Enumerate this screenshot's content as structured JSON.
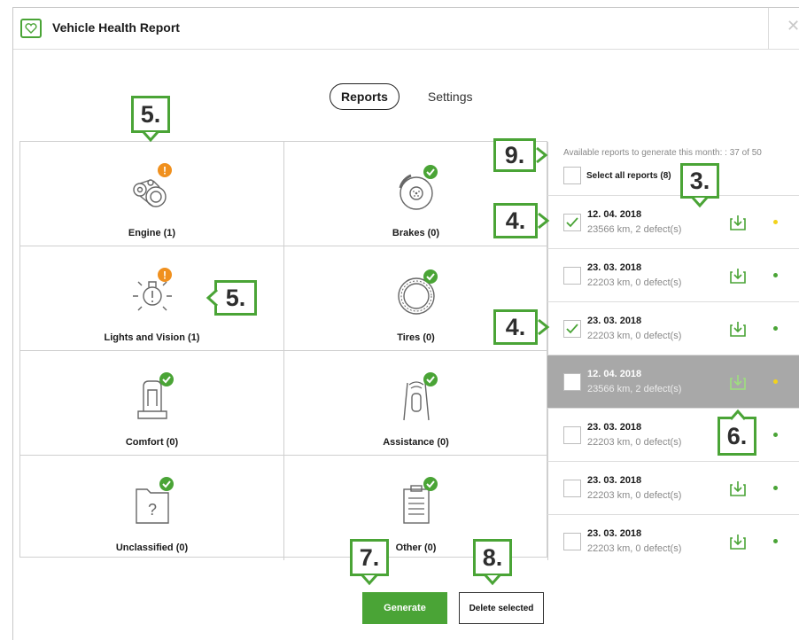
{
  "app": {
    "title": "Vehicle Health Report",
    "icon": "heart-icon",
    "accent": "#4aa436"
  },
  "tabs": [
    {
      "label": "Reports",
      "active": true
    },
    {
      "label": "Settings",
      "active": false
    }
  ],
  "categories": [
    {
      "label": "Engine (1)",
      "icon": "engine-icon",
      "status": "warning"
    },
    {
      "label": "Brakes (0)",
      "icon": "brake-disc-icon",
      "status": "ok"
    },
    {
      "label": "Lights and Vision (1)",
      "icon": "light-bulb-icon",
      "status": "warning"
    },
    {
      "label": "Tires (0)",
      "icon": "tire-icon",
      "status": "ok"
    },
    {
      "label": "Comfort (0)",
      "icon": "seat-icon",
      "status": "ok"
    },
    {
      "label": "Assistance (0)",
      "icon": "lane-assist-icon",
      "status": "ok"
    },
    {
      "label": "Unclassified (0)",
      "icon": "unknown-folder-icon",
      "status": "ok"
    },
    {
      "label": "Other (0)",
      "icon": "clipboard-icon",
      "status": "ok"
    }
  ],
  "reports_panel": {
    "available_text": "Available reports to generate this month: : 37 of 50",
    "select_all_label": "Select all reports (8)",
    "reports": [
      {
        "date": "12. 04. 2018",
        "summary": "23566 km, 2 defect(s)",
        "checked": true,
        "highlighted": false,
        "status_color": "#f2d21b"
      },
      {
        "date": "23. 03. 2018",
        "summary": "22203 km, 0 defect(s)",
        "checked": false,
        "highlighted": false,
        "status_color": "#4aa436"
      },
      {
        "date": "23. 03. 2018",
        "summary": "22203 km, 0 defect(s)",
        "checked": true,
        "highlighted": false,
        "status_color": "#4aa436"
      },
      {
        "date": "12. 04. 2018",
        "summary": "23566 km, 2 defect(s)",
        "checked": false,
        "highlighted": true,
        "status_color": "#f2d21b"
      },
      {
        "date": "23. 03. 2018",
        "summary": "22203 km, 0 defect(s)",
        "checked": false,
        "highlighted": false,
        "status_color": "#4aa436"
      },
      {
        "date": "23. 03. 2018",
        "summary": "22203 km, 0 defect(s)",
        "checked": false,
        "highlighted": false,
        "status_color": "#4aa436"
      },
      {
        "date": "23. 03. 2018",
        "summary": "22203 km, 0 defect(s)",
        "checked": false,
        "highlighted": false,
        "status_color": "#4aa436"
      }
    ]
  },
  "buttons": {
    "generate": "Generate",
    "delete_selected": "Delete selected"
  },
  "callouts": [
    "5.",
    "5.",
    "9.",
    "3.",
    "4.",
    "4.",
    "6.",
    "7.",
    "8."
  ],
  "colors": {
    "ok": "#4aa436",
    "warning": "#f0901e",
    "highlight_row": "#a8a8a8"
  }
}
